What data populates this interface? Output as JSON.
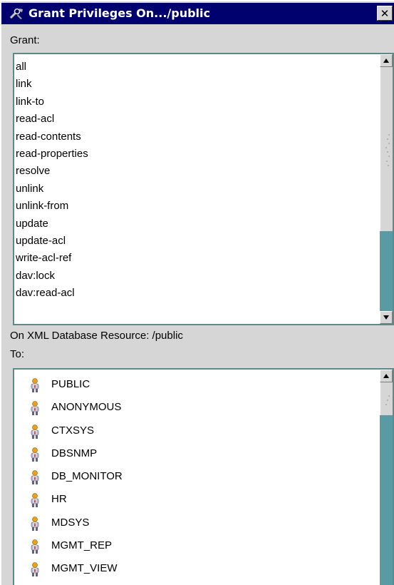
{
  "window": {
    "title": "Grant Privileges On.../public",
    "close_label": "✕"
  },
  "grant": {
    "label": "Grant:",
    "items": [
      "all",
      "link",
      "link-to",
      "read-acl",
      "read-contents",
      "read-properties",
      "resolve",
      "unlink",
      "unlink-from",
      "update",
      "update-acl",
      "write-acl-ref",
      "dav:lock",
      "dav:read-acl"
    ]
  },
  "resource": {
    "label": "On XML Database Resource: /public"
  },
  "to": {
    "label": "To:",
    "items": [
      "PUBLIC",
      "ANONYMOUS",
      "CTXSYS",
      "DBSNMP",
      "DB_MONITOR",
      "HR",
      "MDSYS",
      "MGMT_REP",
      "MGMT_VIEW"
    ]
  },
  "icons": {
    "title": "wrench-tools-icon",
    "user": "user-icon"
  },
  "colors": {
    "titlebar": "#00006e",
    "list_border": "#5a8a8a",
    "scroll_track": "#5a9aa5"
  }
}
